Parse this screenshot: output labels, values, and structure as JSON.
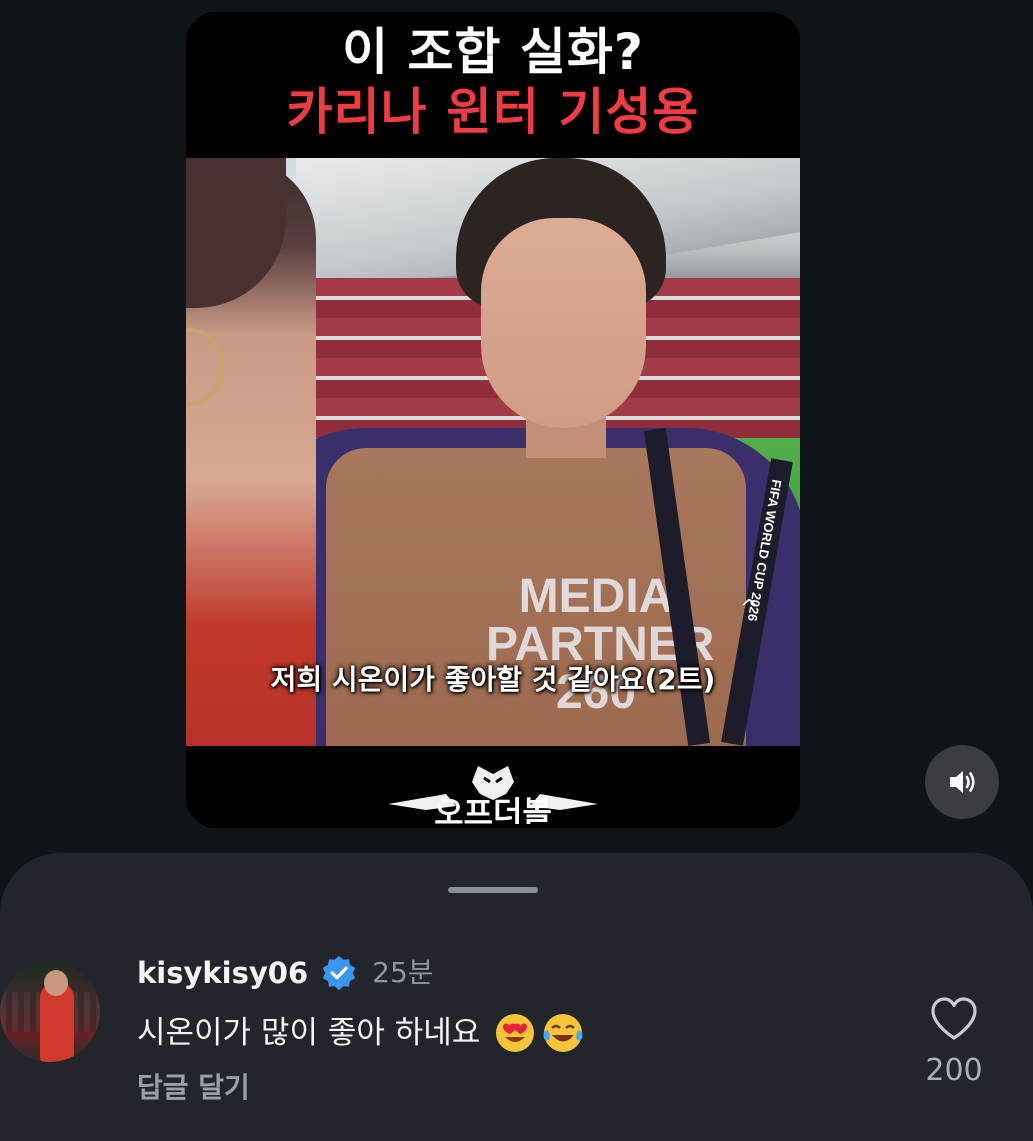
{
  "video": {
    "title_line1": "이 조합 실화?",
    "title_line2": "카리나 윈터 기성용",
    "caption": "저희 시온이가 좋아할 것 같아요(2트)",
    "vest_text": "MEDIA PARTNER",
    "vest_number": "260",
    "lanyard_text": "FIFA WORLD CUP 2026",
    "brand_logo_text": "오프더볼",
    "title_color": "#ffffff",
    "title_accent_color": "#ef3b43"
  },
  "sound_button": {
    "icon": "speaker-icon"
  },
  "comment": {
    "username": "kisykisy06",
    "verified_icon": "verified-badge-icon",
    "time": "25분",
    "text": "시온이가 많이 좋아 하네요",
    "emojis": [
      "heart-eyes-emoji",
      "tears-of-joy-emoji"
    ],
    "reply_label": "답글 달기",
    "like_icon": "heart-outline-icon",
    "like_count": "200"
  },
  "colors": {
    "background": "#0f1419",
    "sheet": "#22262c",
    "verified": "#3c95f0"
  }
}
